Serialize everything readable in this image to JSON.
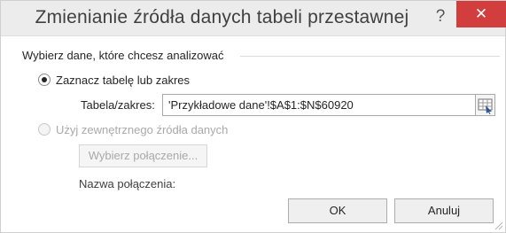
{
  "titlebar": {
    "title": "Zmienianie źródła danych tabeli przestawnej",
    "help_label": "?",
    "close_label": "✕"
  },
  "group": {
    "label": "Wybierz dane, które chcesz analizować"
  },
  "option_table": {
    "label": "Zaznacz tabelę lub zakres",
    "selected": true
  },
  "range_field": {
    "label": "Tabela/zakres:",
    "value": "'Przykładowe dane'!$A$1:$N$60920"
  },
  "option_external": {
    "label": "Użyj zewnętrznego źródła danych",
    "selected": false,
    "enabled": false
  },
  "connection": {
    "button_label": "Wybierz połączenie...",
    "name_label": "Nazwa połączenia:"
  },
  "buttons": {
    "ok": "OK",
    "cancel": "Anuluj"
  },
  "colors": {
    "close_red": "#d23d3d",
    "titlebar_bg": "#ececec",
    "disabled_text": "#a9a9a9"
  }
}
